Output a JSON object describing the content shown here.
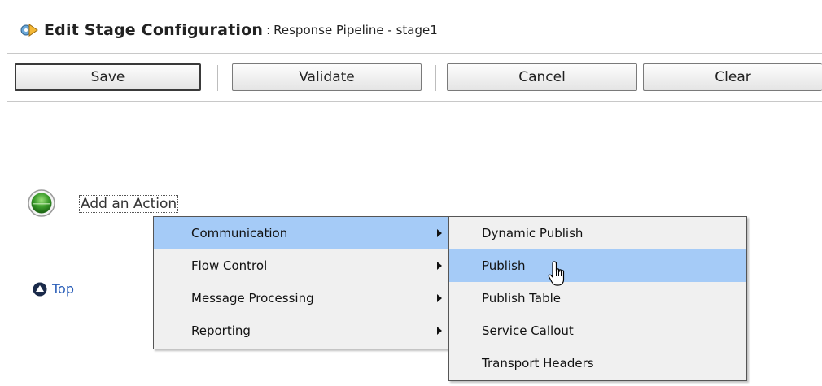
{
  "header": {
    "title": "Edit Stage Configuration",
    "separator": ":",
    "subtitle": "Response Pipeline - stage1",
    "icon": "stage-config-icon"
  },
  "toolbar": {
    "save_label": "Save",
    "validate_label": "Validate",
    "cancel_label": "Cancel",
    "clear_label": "Clear"
  },
  "content": {
    "add_action_label": "Add an Action",
    "add_action_icon": "green-circle-icon",
    "top_label": "Top",
    "top_icon": "up-arrow-circle-icon"
  },
  "menu_primary": {
    "items": [
      {
        "label": "Communication",
        "has_submenu": true,
        "active": true
      },
      {
        "label": "Flow Control",
        "has_submenu": true,
        "active": false
      },
      {
        "label": "Message Processing",
        "has_submenu": true,
        "active": false
      },
      {
        "label": "Reporting",
        "has_submenu": true,
        "active": false
      }
    ]
  },
  "menu_secondary": {
    "items": [
      {
        "label": "Dynamic Publish",
        "active": false
      },
      {
        "label": "Publish",
        "active": true
      },
      {
        "label": "Publish Table",
        "active": false
      },
      {
        "label": "Service Callout",
        "active": false
      },
      {
        "label": "Transport Headers",
        "active": false
      }
    ]
  },
  "colors": {
    "highlight": "#a5cbf7",
    "link": "#2a5eb8",
    "menu_bg": "#f0f0f0",
    "action_green": "#3a9a2a"
  }
}
